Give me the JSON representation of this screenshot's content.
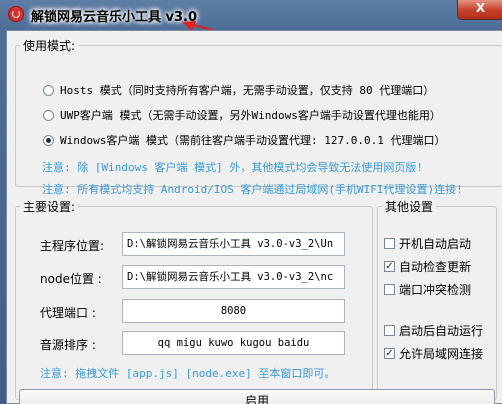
{
  "window": {
    "title": "解锁网易云音乐小工具 v3.0",
    "close_glyph": "X"
  },
  "mode": {
    "group_label": "使用模式:",
    "options": [
      {
        "label": "Hosts 模式（同时支持所有客户端，无需手动设置，仅支持 80 代理端口）",
        "selected": false
      },
      {
        "label": "UWP客户端 模式（无需手动设置，另外Windows客户端手动设置代理也能用）",
        "selected": false
      },
      {
        "label": "Windows客户端 模式（需前往客户端手动设置代理: 127.0.0.1 代理端口）",
        "selected": true
      }
    ],
    "notes": [
      "注意: 除 [Windows 客户端 模式] 外，其他模式均会导致无法使用网页版!",
      "注意: 所有模式均支持 Android/IOS 客户端通过局域网(手机WIFI代理设置)连接!"
    ]
  },
  "main": {
    "group_label": "主要设置:",
    "fields": [
      {
        "label": "主程序位置:",
        "value": "D:\\解锁网易云音乐小工具 v3.0-v3_2\\Un"
      },
      {
        "label": "node位置  :",
        "value": "D:\\解锁网易云音乐小工具 v3.0-v3_2\\nc"
      },
      {
        "label": "代理端口  :",
        "value": "8080"
      },
      {
        "label": "音源排序  :",
        "value": "qq migu kuwo kugou baidu"
      }
    ],
    "hint": "注意: 拖拽文件 [app.js] [node.exe] 至本窗口即可。"
  },
  "other": {
    "group_label": "其他设置",
    "checks": [
      {
        "label": "开机自动启动",
        "checked": false
      },
      {
        "label": "自动检查更新",
        "checked": true
      },
      {
        "label": "端口冲突检测",
        "checked": false
      },
      {
        "label": "启动后自动运行",
        "checked": false
      },
      {
        "label": "允许局域网连接",
        "checked": true
      }
    ]
  },
  "actions": {
    "start_label": "启用"
  },
  "colors": {
    "note_text": "#3a9ad8",
    "annotation_arrow": "#e02020"
  }
}
